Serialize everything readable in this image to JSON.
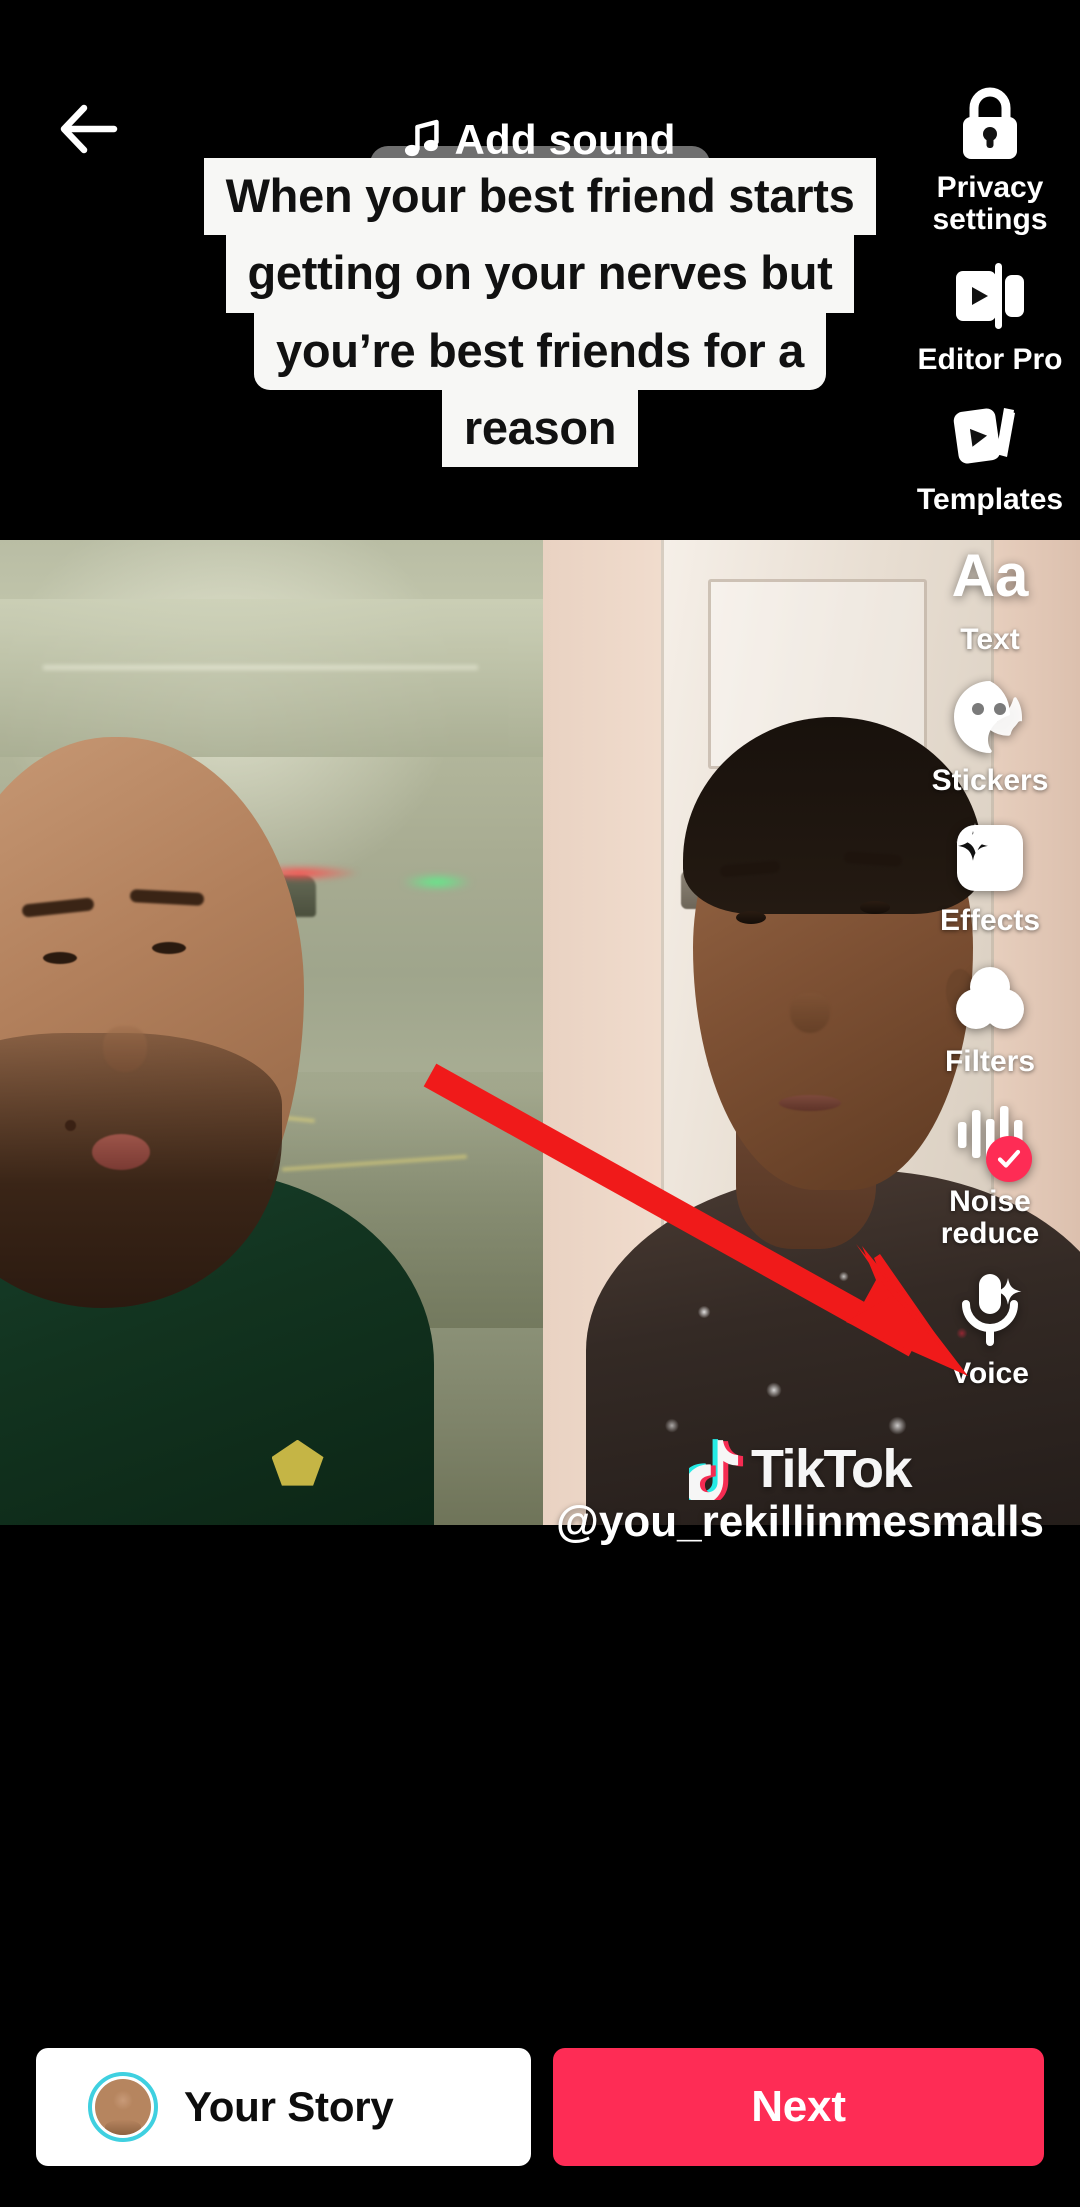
{
  "app": {
    "name": "TikTok",
    "screen": "post-edit",
    "accent_color": "#fe2c55",
    "background_color": "#000000"
  },
  "top_bar": {
    "back_icon": "arrow-left-icon",
    "add_sound_label": "Add sound",
    "music_icon": "music-note-icon"
  },
  "caption_overlay": {
    "lines": [
      "When your best friend starts",
      "getting on your nerves but",
      "you’re best friends for a",
      "reason"
    ],
    "text_color": "#111111",
    "background_color": "#f7f7f5"
  },
  "tool_sidebar": {
    "items": [
      {
        "id": "privacy-settings",
        "label": "Privacy\nsettings",
        "label_line1": "Privacy",
        "label_line2": "settings",
        "icon": "lock-icon",
        "badge": null
      },
      {
        "id": "editor-pro",
        "label": "Editor Pro",
        "label_line1": "Editor Pro",
        "label_line2": "",
        "icon": "editor-pro-icon",
        "badge": null
      },
      {
        "id": "templates",
        "label": "Templates",
        "label_line1": "Templates",
        "label_line2": "",
        "icon": "templates-cards-icon",
        "badge": null
      },
      {
        "id": "text",
        "label": "Text",
        "label_line1": "Text",
        "label_line2": "",
        "icon": "text-aa-icon",
        "badge": null
      },
      {
        "id": "stickers",
        "label": "Stickers",
        "label_line1": "Stickers",
        "label_line2": "",
        "icon": "sticker-face-icon",
        "badge": null
      },
      {
        "id": "effects",
        "label": "Effects",
        "label_line1": "Effects",
        "label_line2": "",
        "icon": "sparkles-icon",
        "badge": null
      },
      {
        "id": "filters",
        "label": "Filters",
        "label_line1": "Filters",
        "label_line2": "",
        "icon": "filters-circles-icon",
        "badge": null
      },
      {
        "id": "noise-reduce",
        "label": "Noise\nreduce",
        "label_line1": "Noise",
        "label_line2": "reduce",
        "icon": "waveform-icon",
        "badge": "check-badge",
        "badge_color": "#fe2c55"
      },
      {
        "id": "voice",
        "label": "Voice",
        "label_line1": "Voice",
        "label_line2": "",
        "icon": "microphone-sparkle-icon",
        "badge": null
      }
    ]
  },
  "video_watermark": {
    "brand": "TikTok",
    "logo_icon": "tiktok-note-icon",
    "username": "@you_rekillinmesmalls"
  },
  "annotation": {
    "type": "arrow",
    "color": "#f01a1a",
    "points_to": "noise-reduce"
  },
  "bottom_bar": {
    "your_story_label": "Your Story",
    "your_story_avatar": "user-avatar",
    "next_label": "Next",
    "next_color": "#fe2c55"
  }
}
